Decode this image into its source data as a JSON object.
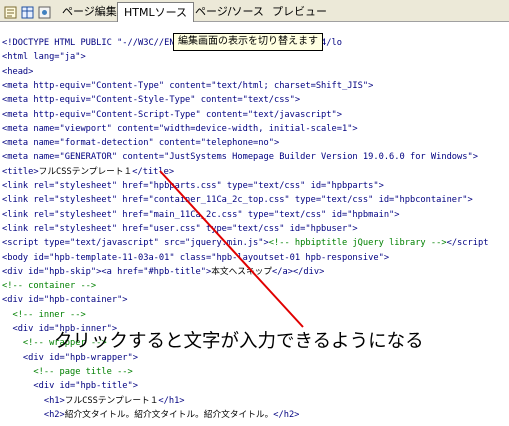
{
  "tabs": [
    {
      "label": "ページ編集"
    },
    {
      "label": "HTMLソース"
    },
    {
      "label": "ページ/ソース"
    },
    {
      "label": "プレビュー"
    }
  ],
  "tooltip": "編集画面の表示を切り替えます",
  "annotation": "クリックすると文字が入力できるようになる",
  "colors": {
    "tag": "#000080",
    "attr_value": "#a00000",
    "comment": "#008000",
    "annotation_line": "#e00000"
  },
  "code_lines": [
    [
      [
        "tg",
        "<!DOCTYPE HTML PUBLIC \"-//W3C/"
      ],
      [
        "tg",
        "/EN\" \"http://www.w3.org/TR/html4/lo"
      ]
    ],
    [
      [
        "tg",
        "<html lang=\"ja\">"
      ]
    ],
    [
      [
        "tg",
        "<head>"
      ]
    ],
    [
      [
        "tg",
        "<meta http-equiv=\"Content-Type\" content=\"text/html; charset=Shift_JIS\">"
      ]
    ],
    [
      [
        "tg",
        "<meta http-equiv=\"Content-Style-Type\" content=\"text/css\">"
      ]
    ],
    [
      [
        "tg",
        "<meta http-equiv=\"Content-Script-Type\" content=\"text/javascript\">"
      ]
    ],
    [
      [
        "tg",
        "<meta name=\"viewport\" content=\"width=device-width, initial-scale=1\">"
      ]
    ],
    [
      [
        "tg",
        "<meta name=\"format-detection\" content=\"telephone=no\">"
      ]
    ],
    [
      [
        "tg",
        "<meta name=\"GENERATOR\" content=\"JustSystems Homepage Builder Version 19.0.6.0 for Windows\">"
      ]
    ],
    [
      [
        "tg",
        "<title>"
      ],
      [
        "tx",
        "フルCSSテンプレート１"
      ],
      [
        "tg",
        "</title>"
      ]
    ],
    [
      [
        "tg",
        "<link rel=\"stylesheet\" href=\"hpbparts.css\" type=\"text/css\" id=\"hpbparts\">"
      ]
    ],
    [
      [
        "tg",
        "<link rel=\"stylesheet\" href=\"container_11Ca_2c_top.css\" type=\"text/css\" id=\"hpbcontainer\">"
      ]
    ],
    [
      [
        "tg",
        "<link rel=\"stylesheet\" href=\"main_11Ca_2c.css\" type=\"text/css\" id=\"hpbmain\">"
      ]
    ],
    [
      [
        "tg",
        "<link rel=\"stylesheet\" href=\"user.css\" type=\"text/css\" id=\"hpbuser\">"
      ]
    ],
    [
      [
        "tg",
        "<script type=\"text/javascript\" src=\"jquery.min.js\">"
      ],
      [
        "cm",
        "<!-- hpbiptitle jQuery library -->"
      ],
      [
        "tg",
        "</script"
      ]
    ],
    [
      [
        "tg",
        "<body id=\"hpb-template-11-03a-01\" class=\"hpb-layoutset-01 hpb-responsive\">"
      ]
    ],
    [
      [
        "tg",
        "<div id=\"hpb-skip\"><a href=\"#hpb-title\">"
      ],
      [
        "tx",
        "本文へスキップ"
      ],
      [
        "tg",
        "</a></div>"
      ]
    ],
    [
      [
        "cm",
        "<!-- container -->"
      ]
    ],
    [
      [
        "tg",
        "<div id=\"hpb-container\">"
      ]
    ],
    [
      [
        "cm",
        "  <!-- inner -->"
      ]
    ],
    [
      [
        "tg",
        "  <div id=\"hpb-inner\">"
      ]
    ],
    [
      [
        "cm",
        "    <!-- wrapper -->"
      ]
    ],
    [
      [
        "tg",
        "    <div id=\"hpb-wrapper\">"
      ]
    ],
    [
      [
        "cm",
        "      <!-- page title -->"
      ]
    ],
    [
      [
        "tg",
        "      <div id=\"hpb-title\">"
      ]
    ],
    [
      [
        "tg",
        "        <h1>"
      ],
      [
        "tx",
        "フルCSSテンプレート１"
      ],
      [
        "tg",
        "</h1>"
      ]
    ],
    [
      [
        "tg",
        "        <h2>"
      ],
      [
        "tx",
        "紹介文タイトル。紹介文タイトル。紹介文タイトル。"
      ],
      [
        "tg",
        "</h2>"
      ]
    ]
  ]
}
